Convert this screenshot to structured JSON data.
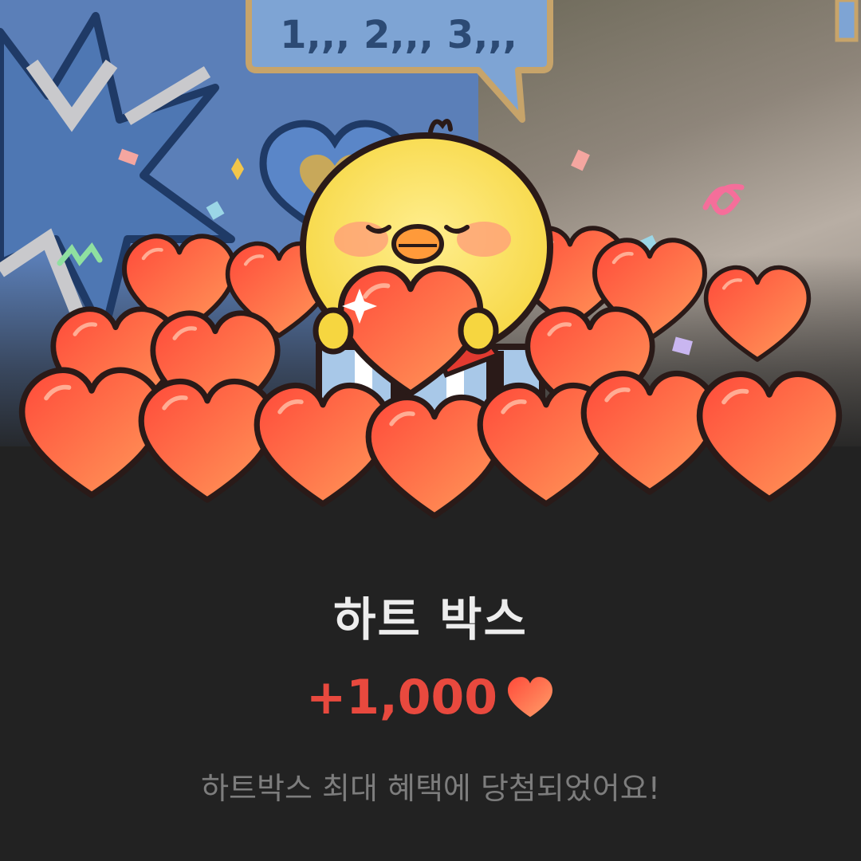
{
  "backdrop": {
    "speech_bubble_text": "1,,, 2,,, 3,,,"
  },
  "reward": {
    "title": "하트 박스",
    "amount": "+1,000",
    "currency_icon": "heart-icon",
    "message": "하트박스 최대 혜택에 당첨되었어요!"
  },
  "colors": {
    "background": "#222222",
    "amount": "#e8493e",
    "title": "#ededed",
    "message": "#7d7d7d",
    "heart": "#f2583e"
  }
}
